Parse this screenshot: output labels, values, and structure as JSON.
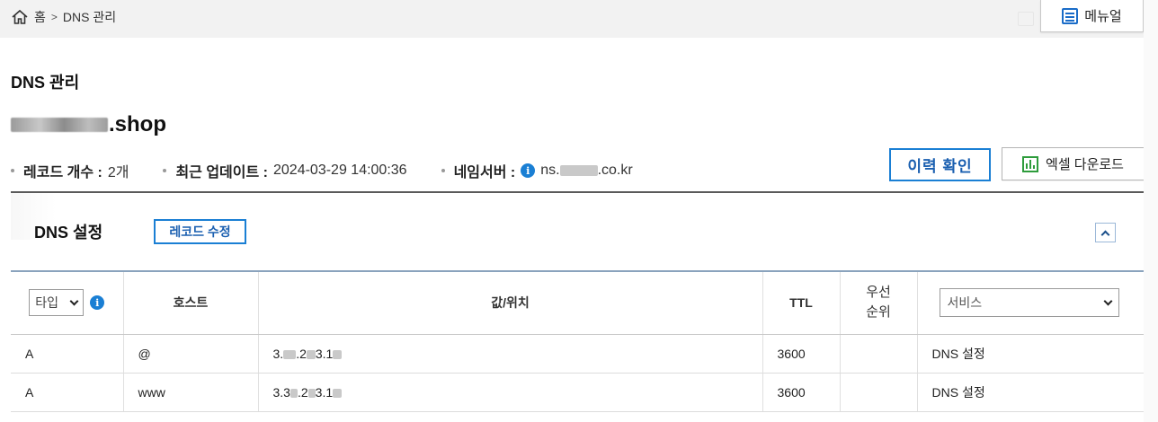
{
  "breadcrumb": {
    "home": "홈",
    "separator": ">",
    "current": "DNS 관리"
  },
  "manual_button": "메뉴얼",
  "page_title": "DNS 관리",
  "domain": {
    "suffix": ".shop"
  },
  "meta": {
    "record_count_label": "레코드 개수 :",
    "record_count_value": "2개",
    "updated_label": "최근 업데이트 :",
    "updated_value": "2024-03-29 14:00:36",
    "nameserver_label": "네임서버 :",
    "nameserver_prefix": "ns.",
    "nameserver_suffix": ".co.kr"
  },
  "buttons": {
    "history": "이력 확인",
    "excel": "엑셀 다운로드",
    "edit_records": "레코드 수정"
  },
  "section_title": "DNS 설정",
  "table": {
    "headers": {
      "type": "타입",
      "host": "호스트",
      "value": "값/위치",
      "ttl": "TTL",
      "priority_line1": "우선",
      "priority_line2": "순위",
      "service": "서비스"
    },
    "rows": [
      {
        "type": "A",
        "host": "@",
        "value_parts": [
          "3.",
          ".2",
          "3.1"
        ],
        "ttl": "3600",
        "priority": "",
        "service": "DNS 설정"
      },
      {
        "type": "A",
        "host": "www",
        "value_parts": [
          "3.3",
          ".2",
          "3.1"
        ],
        "ttl": "3600",
        "priority": "",
        "service": "DNS 설정"
      }
    ]
  },
  "colors": {
    "accent": "#1a7fd4",
    "excel_green": "#2e9c3c",
    "topbar": "#f2f2f2"
  }
}
